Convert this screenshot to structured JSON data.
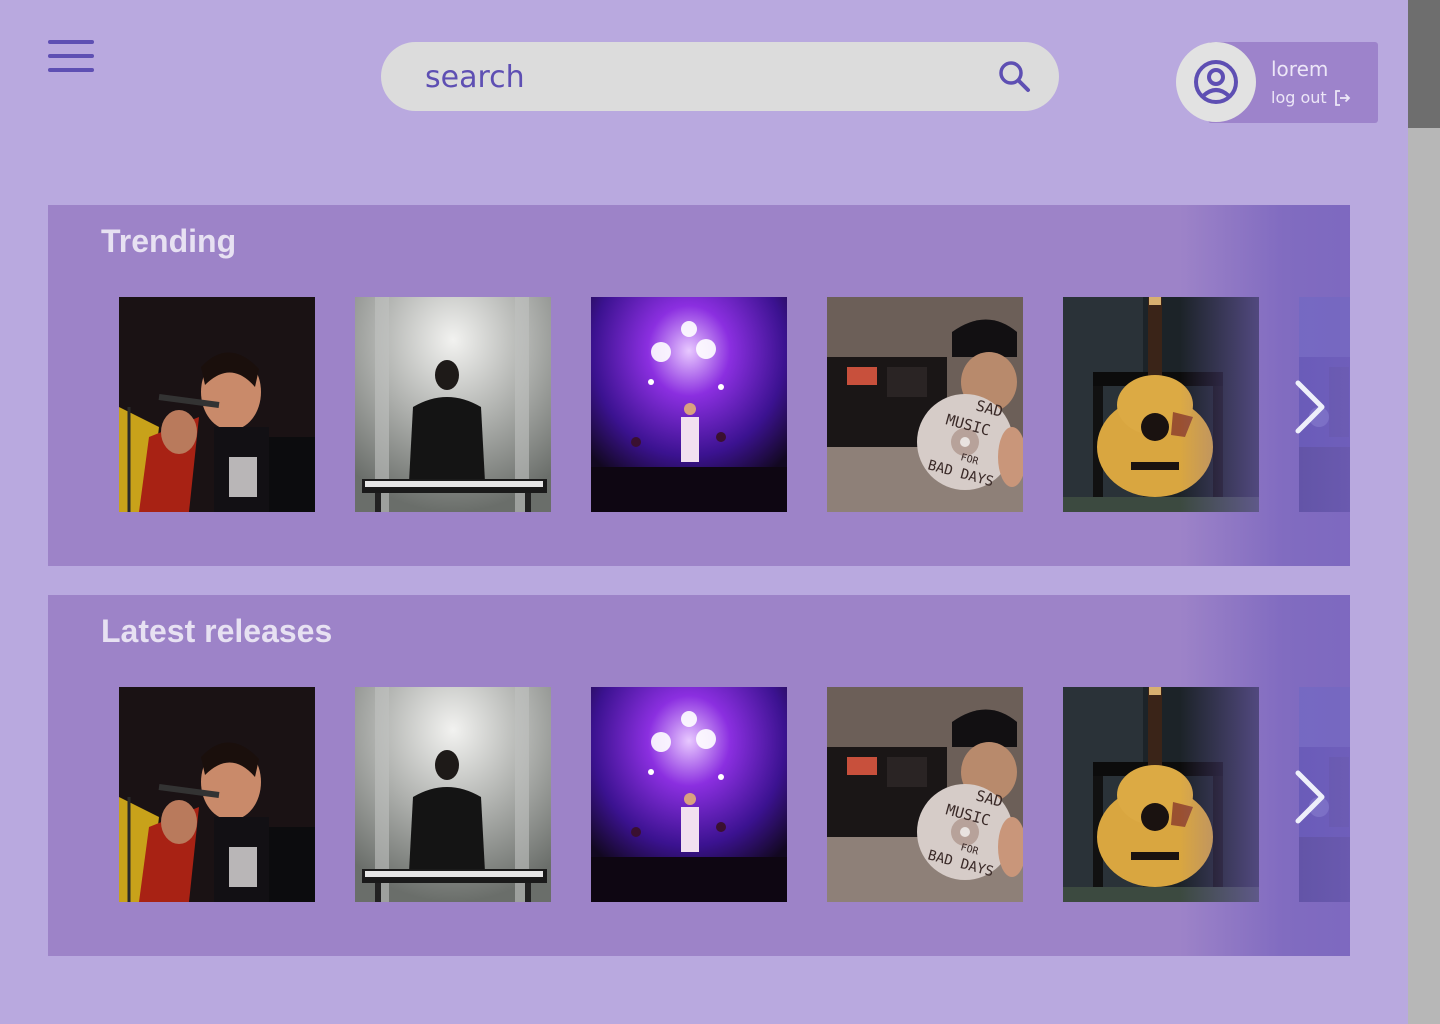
{
  "header": {
    "search": {
      "placeholder": "search",
      "value": ""
    },
    "user": {
      "name": "lorem",
      "logout_label": "log out"
    }
  },
  "sections": [
    {
      "title": "Trending",
      "items": [
        {
          "image": "singer-with-microphone"
        },
        {
          "image": "keyboard-player-on-stage"
        },
        {
          "image": "concert-purple-lights"
        },
        {
          "image": "sad-music-for-bad-days-cd"
        },
        {
          "image": "acoustic-guitar"
        },
        {
          "image": "crowd-concert-partial"
        }
      ]
    },
    {
      "title": "Latest releases",
      "items": [
        {
          "image": "singer-with-microphone"
        },
        {
          "image": "keyboard-player-on-stage"
        },
        {
          "image": "concert-purple-lights"
        },
        {
          "image": "sad-music-for-bad-days-cd"
        },
        {
          "image": "acoustic-guitar"
        },
        {
          "image": "crowd-concert-partial"
        }
      ]
    }
  ],
  "cd_text": {
    "line1": "SAD",
    "line2": "MUSIC",
    "line3": "FOR",
    "line4": "BAD DAYS"
  },
  "colors": {
    "background": "#b9a9df",
    "accent": "#5e4fb3",
    "panel": "#9d83c8",
    "search_bg": "#dcdcdc"
  }
}
